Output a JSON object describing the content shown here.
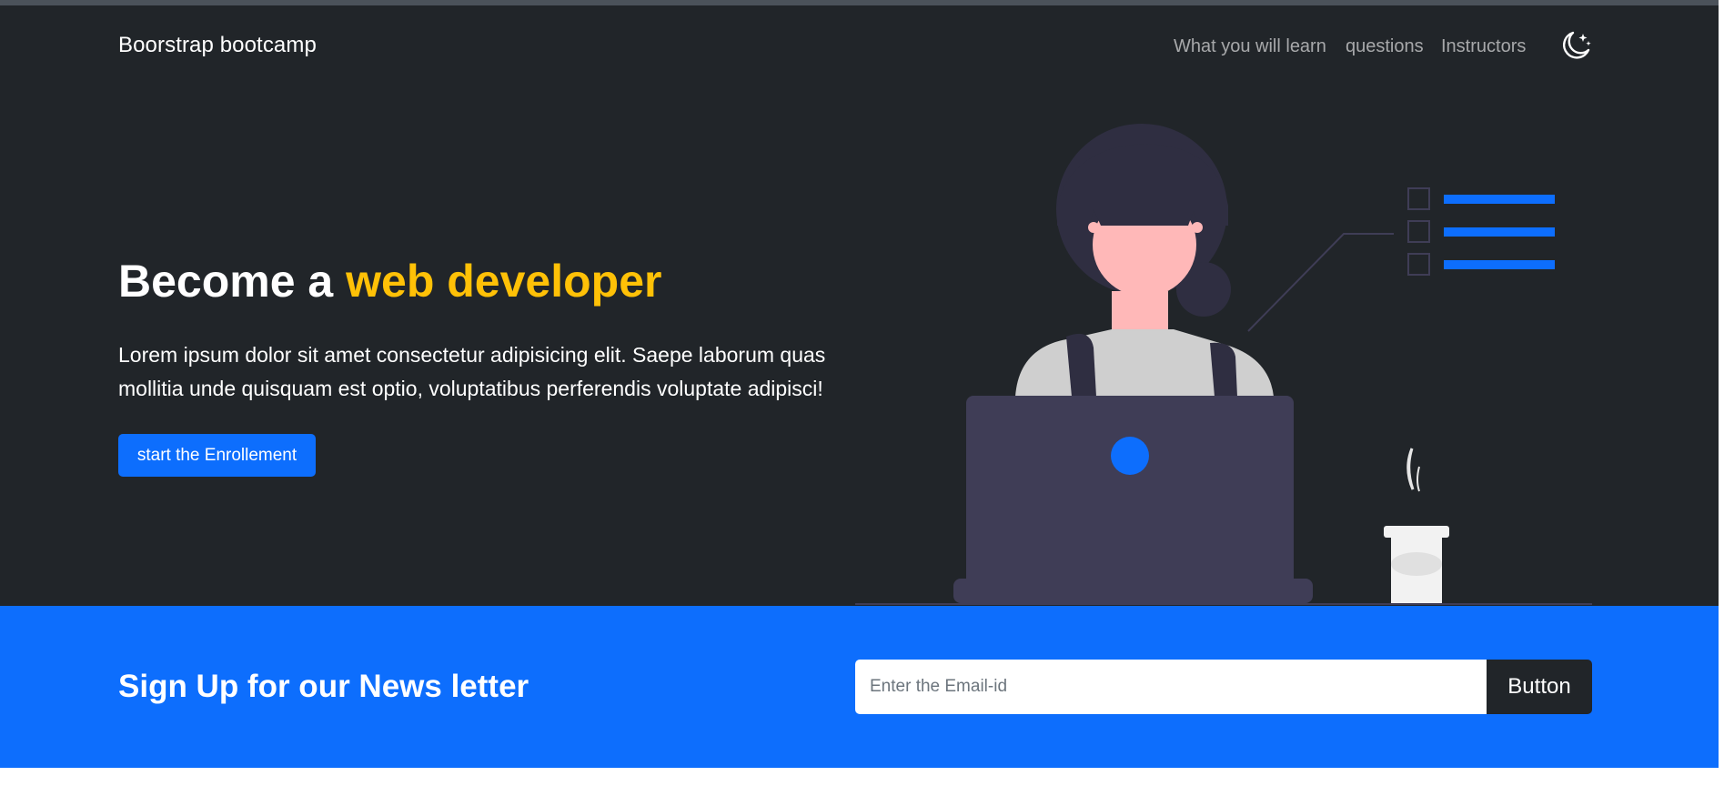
{
  "navbar": {
    "brand": "Boorstrap bootcamp",
    "links": [
      {
        "label": "What you will learn"
      },
      {
        "label": "questions"
      },
      {
        "label": "Instructors"
      }
    ],
    "theme_toggle_icon": "moon-stars-icon"
  },
  "hero": {
    "title_start": "Become a ",
    "title_highlight": "web developer",
    "lead": "Lorem ipsum dolor sit amet consectetur adipisicing elit. Saepe laborum quas mollitia unde quisquam est optio, voluptatibus perferendis voluptate adipisci!",
    "cta_label": "start the Enrollement",
    "illustration_icon": "woman-with-laptop-illustration"
  },
  "newsletter": {
    "title": "Sign Up for our News letter",
    "email_placeholder": "Enter the Email-id",
    "email_value": "",
    "button_label": "Button"
  },
  "colors": {
    "dark_bg": "#212529",
    "primary": "#0d6efd",
    "highlight": "#ffc107",
    "nav_muted": "rgba(255,255,255,0.6)"
  }
}
